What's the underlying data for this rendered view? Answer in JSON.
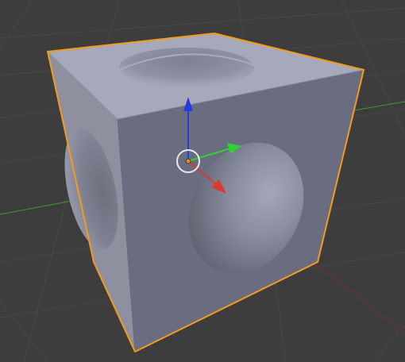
{
  "viewport": {
    "background_color": "#3d3d3d",
    "grid_color": "#474747",
    "axis_x_color": "#b03a3a",
    "axis_y_color": "#3f9b2a"
  },
  "object": {
    "selected": true,
    "outline_color": "#f29b1d",
    "face_colors": {
      "top": "#a6a9ba",
      "left": "#8e909f",
      "front": "#6e7183"
    }
  },
  "gizmo": {
    "x_axis_color": "#d83a2f",
    "y_axis_color": "#2fd32f",
    "z_axis_color": "#2a3bdc",
    "ring_color": "#e8e8e8",
    "center_color": "#e38a3a"
  }
}
